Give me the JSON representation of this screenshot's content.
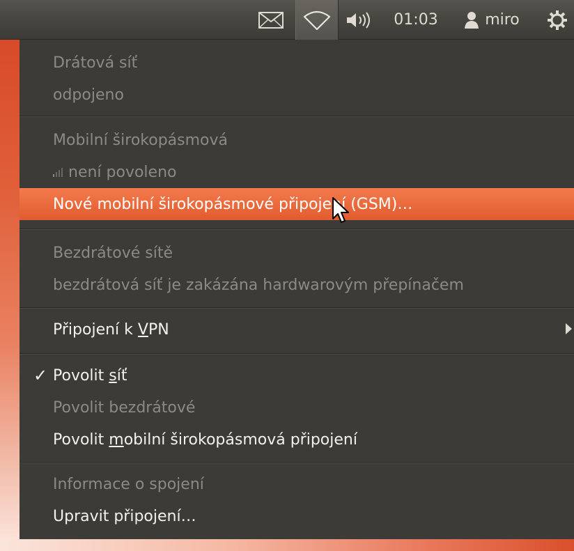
{
  "panel": {
    "clock": "01:03",
    "username": "miro",
    "icons": [
      "envelope-icon",
      "wireless-icon",
      "volume-icon",
      "user-icon",
      "gear-icon"
    ]
  },
  "menu": {
    "wired_title": "Drátová síť",
    "wired_status": "odpojeno",
    "mobile_title": "Mobilní širokopásmová",
    "mobile_status": "není povoleno",
    "new_gsm": "Nové mobilní širokopásmové připojení (GSM)…",
    "wireless_title": "Bezdrátové sítě",
    "wireless_status": "bezdrátová síť je zakázána hardwarovým přepínačem",
    "vpn_pre": "Připojení k ",
    "vpn_mnemonic": "V",
    "vpn_post": "PN",
    "enable_network_pre": "Povolit ",
    "enable_network_mnemonic": "s",
    "enable_network_post": "íť",
    "enable_network_checked": true,
    "enable_wireless": "Povolit bezdrátové",
    "enable_mobile_pre": "Povolit ",
    "enable_mobile_mnemonic": "m",
    "enable_mobile_post": "obilní širokopásmová připojení",
    "connection_info": "Informace o spojení",
    "edit_connections": "Upravit připojení…"
  },
  "colors": {
    "panel_bg": "#3c3b37",
    "highlight": "#e15c2e",
    "text_enabled": "#f2f1ef",
    "text_disabled": "#8c8a84"
  }
}
